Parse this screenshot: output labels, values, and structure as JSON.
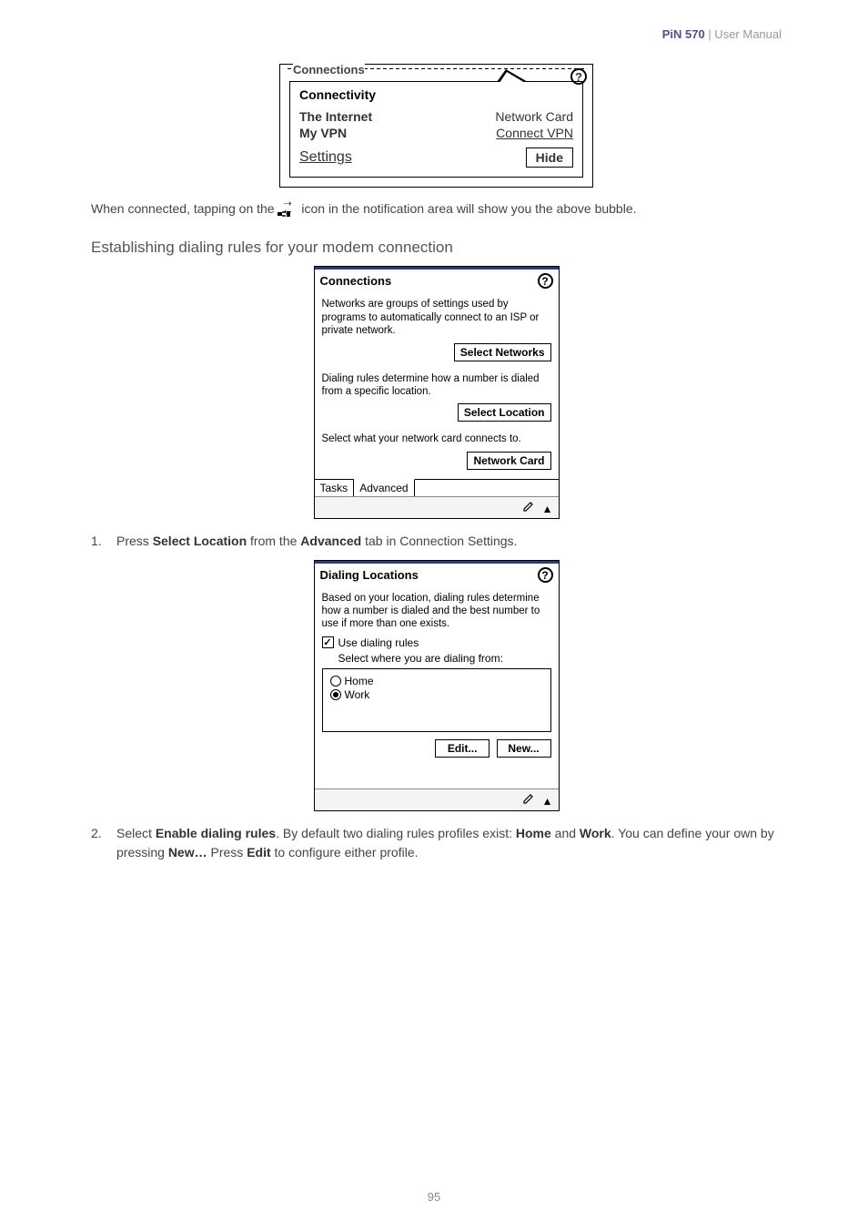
{
  "header": {
    "product": "PiN 570",
    "suffix": " | User Manual"
  },
  "ss1": {
    "torn_title": "Connections",
    "bubble_title": "Connectivity",
    "help": "?",
    "internet_label": "The Internet",
    "internet_right": "Network Card",
    "vpn_label": "My VPN",
    "vpn_link": "Connect VPN",
    "settings_link": "Settings",
    "hide_btn": "Hide"
  },
  "para1": {
    "pre": "When connected, tapping on the ",
    "post": " icon in the notification area will show you the above bubble."
  },
  "heading2": "Establishing dialing rules for your modem connection",
  "ss2": {
    "title": "Connections",
    "help": "?",
    "desc1": "Networks are groups of settings used by programs to automatically connect to an ISP or private network.",
    "btn1": "Select Networks",
    "desc2": "Dialing rules determine how a number is dialed from a specific location.",
    "btn2": "Select Location",
    "desc3": "Select what your network card connects to.",
    "btn3": "Network Card",
    "tab_tasks": "Tasks",
    "tab_advanced": "Advanced"
  },
  "step1": {
    "n": "1.",
    "pre": "Press ",
    "b1": "Select Location",
    "mid": " from the ",
    "b2": "Advanced",
    "post": " tab in Connection Settings."
  },
  "ss3": {
    "title": "Dialing Locations",
    "help": "?",
    "desc": "Based on your location, dialing rules determine how a number is dialed and the best number to use if more than one exists.",
    "checkbox_label": "Use dialing rules",
    "select_label": "Select where you are dialing from:",
    "opt_home": "Home",
    "opt_work": "Work",
    "edit_btn": "Edit...",
    "new_btn": "New..."
  },
  "step2": {
    "n": "2.",
    "pre": "Select ",
    "b1": "Enable dialing rules",
    "mid1": ".  By default two dialing rules profiles exist: ",
    "b2": "Home",
    "mid2": " and ",
    "b3": "Work",
    "mid3": ".   You can define your own by pressing ",
    "b4": "New…",
    "mid4": "   Press ",
    "b5": "Edit",
    "post": " to configure either profile."
  },
  "page_number": "95"
}
